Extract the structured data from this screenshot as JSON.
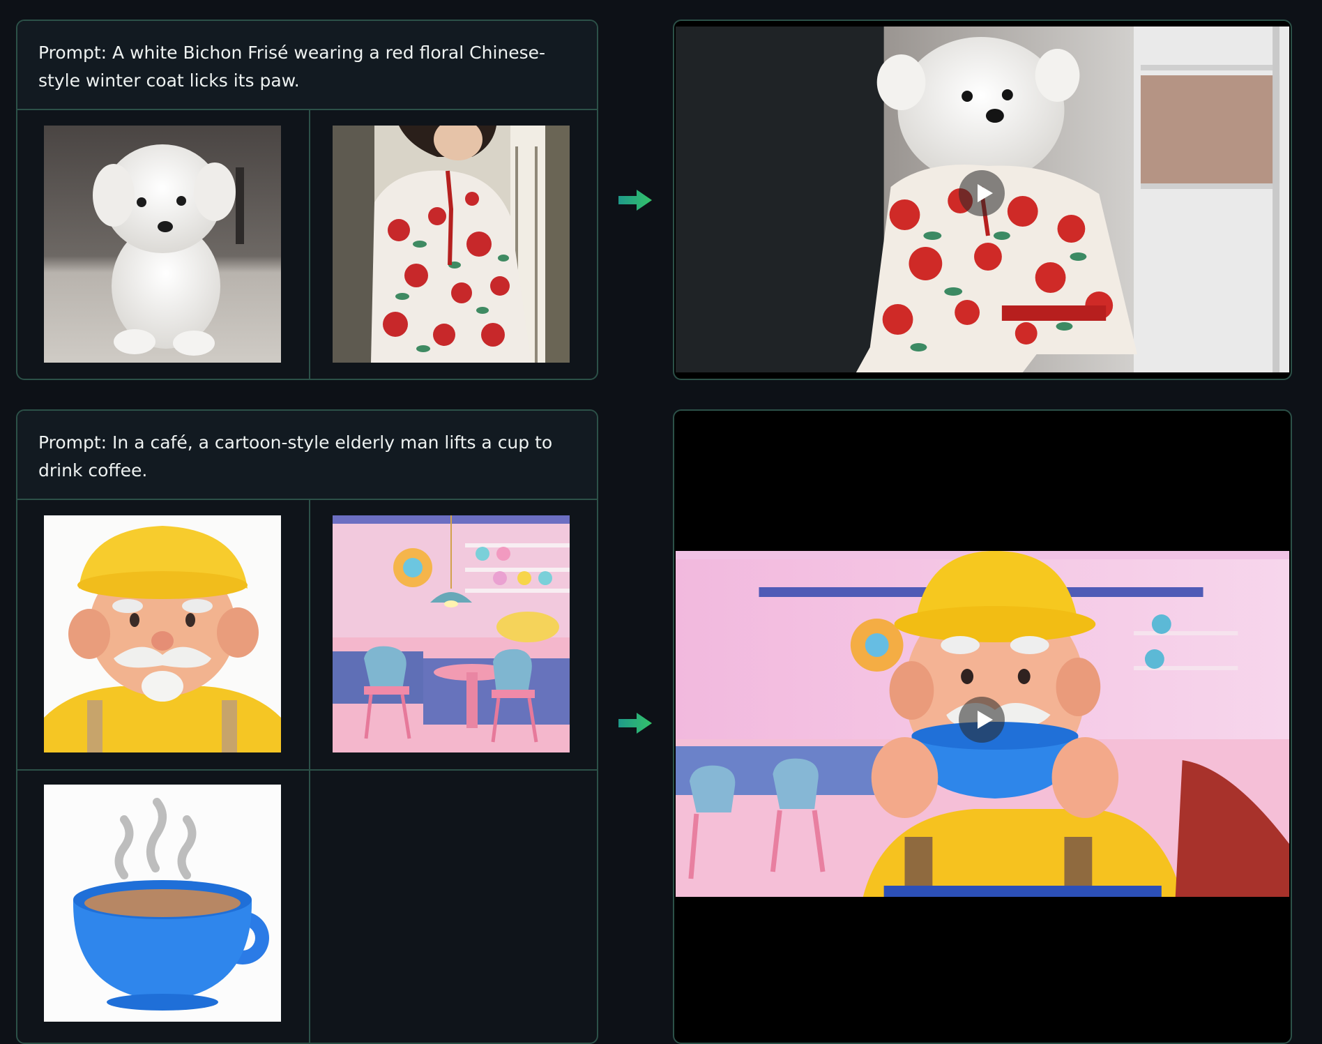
{
  "rows": [
    {
      "prompt": "Prompt: A white Bichon Frisé wearing a red floral Chinese-style winter coat licks its paw.",
      "inputs": [
        "white-bichon-puppy",
        "red-floral-chinese-coat"
      ],
      "output": "bichon-in-floral-coat-video"
    },
    {
      "prompt": "Prompt: In a café, a cartoon-style elderly man lifts a cup to drink coffee.",
      "inputs": [
        "cartoon-elderly-man",
        "pastel-cafe-interior",
        "blue-coffee-cup"
      ],
      "output": "cartoon-man-drinking-coffee-video"
    }
  ],
  "icons": {
    "arrow": "arrow-right-icon",
    "play": "play-icon"
  },
  "colors": {
    "background": "#0d1117",
    "border": "#2c5148",
    "arrow_start": "#1f9a8a",
    "arrow_end": "#34c26a"
  }
}
